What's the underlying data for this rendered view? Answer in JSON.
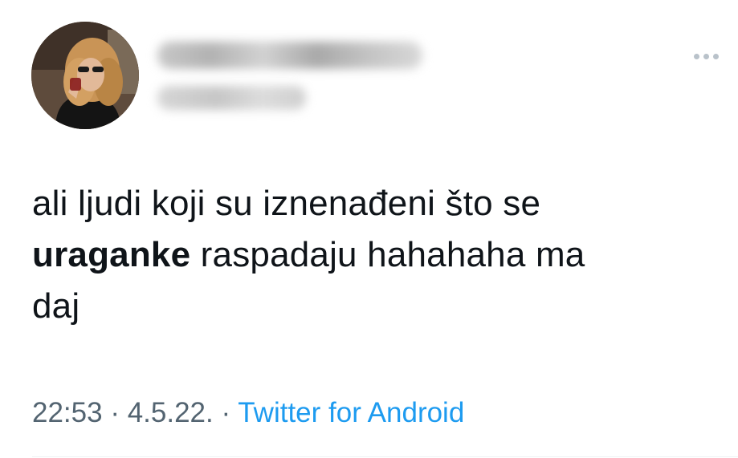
{
  "tweet": {
    "author": {
      "avatar": "profile-photo",
      "display_name": "",
      "handle": ""
    },
    "text": {
      "line1": "ali ljudi koji su iznenađeni što se",
      "highlight": "uraganke",
      "line2_rest": " raspadaju hahahaha ma",
      "line3": "daj"
    },
    "meta": {
      "time": "22:53",
      "sep1": " · ",
      "date": "4.5.22.",
      "sep2": " · ",
      "source": "Twitter for Android"
    },
    "more_icon": "more-horizontal-icon"
  },
  "colors": {
    "text": "#0f1419",
    "secondary": "#536471",
    "link": "#1d9bf0",
    "more_icon": "#b9c2ca"
  }
}
